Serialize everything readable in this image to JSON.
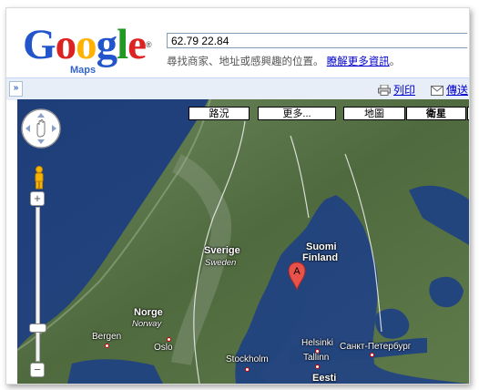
{
  "logo": {
    "letters": [
      "G",
      "o",
      "o",
      "g",
      "l",
      "e"
    ],
    "colors": [
      "#2255cc",
      "#dd2222",
      "#ffb300",
      "#2255cc",
      "#229922",
      "#dd2222"
    ],
    "sub": "Maps",
    "tm": "®"
  },
  "search": {
    "value": "62.79 22.84"
  },
  "hint": {
    "text": "尋找商家、地址或感興趣的位置。",
    "link": "瞭解更多資訊"
  },
  "toolbar": {
    "collapse": "»",
    "print": "列印",
    "send": "傳送"
  },
  "map_controls": {
    "traffic": "路況",
    "more": "更多...",
    "map": "地圖",
    "satellite": "衛星",
    "active": "satellite"
  },
  "zoom": {
    "plus": "+",
    "minus": "−"
  },
  "map_labels": {
    "sverige": "Sverige",
    "sweden": "Sweden",
    "suomi": "Suomi",
    "finland": "Finland",
    "norge": "Norge",
    "norway": "Norway",
    "bergen": "Bergen",
    "oslo": "Oslo",
    "stockholm": "Stockholm",
    "helsinki": "Helsinki",
    "tallinn": "Tallinn",
    "stpetersburg": "Санкт-Петербург",
    "partial": "Eesti"
  },
  "marker": {
    "letter": "A",
    "color": "#e8524a"
  },
  "icons": {
    "pan": "pan-control-icon",
    "pegman": "pegman-icon",
    "print": "printer-icon",
    "send": "envelope-icon"
  }
}
